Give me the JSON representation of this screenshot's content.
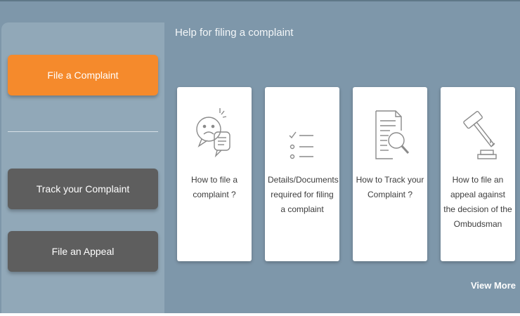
{
  "sidebar": {
    "file_complaint": "File a Complaint",
    "track_complaint": "Track your Complaint",
    "file_appeal": "File an Appeal"
  },
  "main": {
    "title": "Help for filing a complaint",
    "cards": [
      {
        "label": "How to file a complaint ?",
        "icon": "speech-bubbles-icon"
      },
      {
        "label": "Details/Documents required for filing a complaint",
        "icon": "checklist-icon"
      },
      {
        "label": "How to Track your Complaint ?",
        "icon": "document-search-icon"
      },
      {
        "label": "How to file an appeal against the decision of the Ombudsman",
        "icon": "gavel-icon"
      }
    ],
    "view_more": "View More"
  },
  "colors": {
    "background": "#7e97aa",
    "sidebar": "#91a8b8",
    "primary_button": "#f58a2c",
    "secondary_button": "#5e5e5e",
    "card": "#ffffff"
  }
}
